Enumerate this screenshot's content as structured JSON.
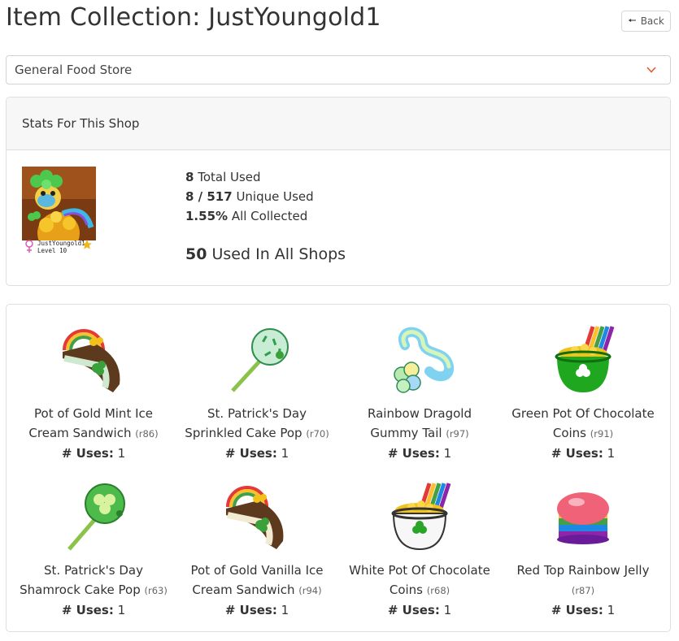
{
  "page": {
    "title": "Item Collection: JustYoungold1",
    "back_label": "Back"
  },
  "shop_select": {
    "value": "General Food Store"
  },
  "stats": {
    "header": "Stats For This Shop",
    "avatar_name": "JustYoungold1",
    "avatar_level": "Level 10",
    "total_used_value": "8",
    "total_used_label": " Total Used",
    "unique_used_value": "8 / 517",
    "unique_used_label": " Unique Used",
    "collected_value": "1.55%",
    "collected_label": " All Collected",
    "all_shops_value": "50",
    "all_shops_label": " Used In All Shops"
  },
  "items": [
    {
      "name_line1": "Pot of Gold Mint Ice",
      "name_line2": "Cream Sandwich",
      "rarity": "(r86)",
      "uses_label": "# Uses:",
      "uses_value": " 1",
      "icon": "ice-cream-sandwich-icon"
    },
    {
      "name_line1": "St. Patrick's Day",
      "name_line2": "Sprinkled Cake Pop",
      "rarity": "(r70)",
      "uses_label": "# Uses:",
      "uses_value": " 1",
      "icon": "cake-pop-icon"
    },
    {
      "name_line1": "Rainbow Dragold",
      "name_line2": "Gummy Tail",
      "rarity": "(r97)",
      "uses_label": "# Uses:",
      "uses_value": " 1",
      "icon": "gummy-tail-icon"
    },
    {
      "name_line1": "Green Pot Of Chocolate",
      "name_line2": "Coins",
      "rarity": "(r91)",
      "uses_label": "# Uses:",
      "uses_value": " 1",
      "icon": "pot-of-gold-icon"
    },
    {
      "name_line1": "St. Patrick's Day",
      "name_line2": "Shamrock Cake Pop",
      "rarity": "(r63)",
      "uses_label": "# Uses:",
      "uses_value": " 1",
      "icon": "shamrock-cake-pop-icon"
    },
    {
      "name_line1": "Pot of Gold Vanilla Ice",
      "name_line2": "Cream Sandwich",
      "rarity": "(r94)",
      "uses_label": "# Uses:",
      "uses_value": " 1",
      "icon": "ice-cream-sandwich-icon"
    },
    {
      "name_line1": "White Pot Of Chocolate",
      "name_line2": "Coins",
      "rarity": "(r68)",
      "uses_label": "# Uses:",
      "uses_value": " 1",
      "icon": "white-pot-icon"
    },
    {
      "name_line1": "Red Top Rainbow Jelly",
      "name_line2": "",
      "rarity": "(r87)",
      "uses_label": "# Uses:",
      "uses_value": " 1",
      "icon": "rainbow-jelly-icon"
    }
  ],
  "colors": {
    "chevron": "#e4572e",
    "gold": "#f2c21b",
    "green": "#2aa52a"
  }
}
